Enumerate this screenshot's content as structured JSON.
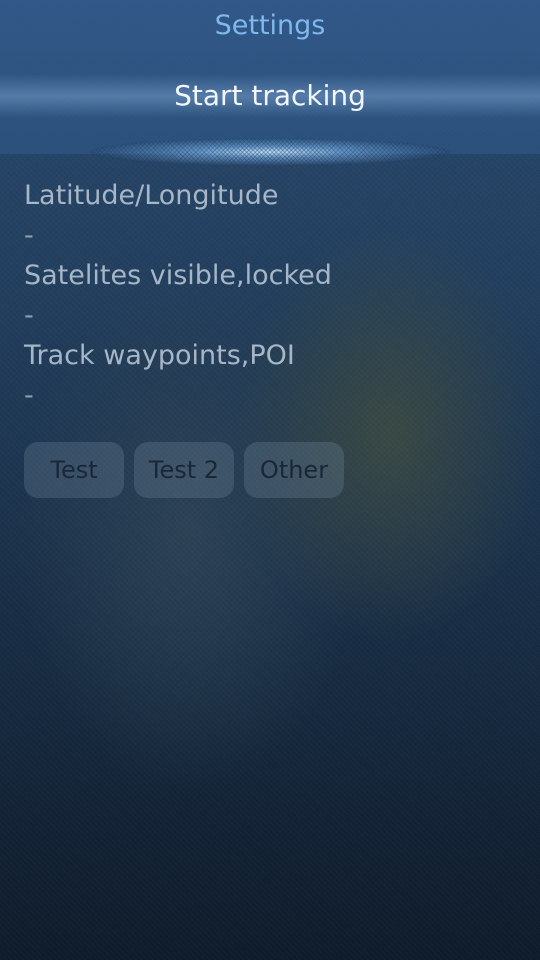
{
  "pulley_menu": {
    "items": [
      {
        "label": "Settings"
      },
      {
        "label": "Start tracking"
      }
    ]
  },
  "info": {
    "position_label": "Latitude/Longitude",
    "position_value": "-",
    "satellites_label": "Satelites visible,locked",
    "satellites_value": "-",
    "track_label": "Track waypoints,POI",
    "track_value": "-"
  },
  "buttons": {
    "test": "Test",
    "test2": "Test 2",
    "other": "Other"
  },
  "colors": {
    "accent": "#7fb7ef",
    "highlight_text": "#f2f6fb",
    "secondary_text": "#a7b6c6"
  }
}
